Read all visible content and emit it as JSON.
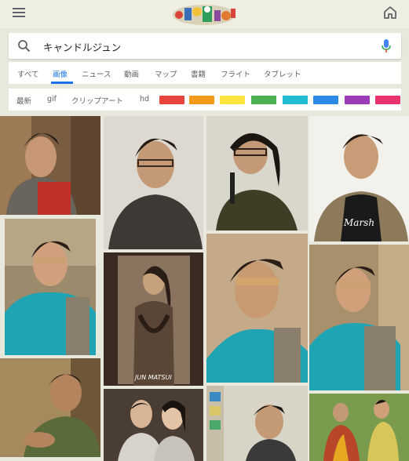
{
  "header": {
    "menu_icon": "hamburger-menu-icon",
    "doodle_icon": "google-doodle-icon",
    "home_icon": "home-icon"
  },
  "search": {
    "query": "キャンドルジュン",
    "search_icon": "search-icon",
    "mic_icon": "mic-icon"
  },
  "tabs": [
    {
      "label": "すべて",
      "active": false
    },
    {
      "label": "画像",
      "active": true
    },
    {
      "label": "ニュース",
      "active": false
    },
    {
      "label": "動画",
      "active": false
    },
    {
      "label": "マップ",
      "active": false
    },
    {
      "label": "書籍",
      "active": false
    },
    {
      "label": "フライト",
      "active": false
    },
    {
      "label": "タブレット",
      "active": false
    }
  ],
  "filters": {
    "chips": [
      "最新",
      "gif",
      "クリップアート",
      "hd"
    ],
    "colors": [
      "#e8453c",
      "#f49a1a",
      "#fbe43e",
      "#4caf50",
      "#21bccf",
      "#2b8be6",
      "#9b3bb5",
      "#e8336d"
    ]
  },
  "colors": {
    "accent": "#1a73e8",
    "background": "#e9e8dc"
  },
  "results": {
    "poster_caption": "JUN MATSUI"
  }
}
